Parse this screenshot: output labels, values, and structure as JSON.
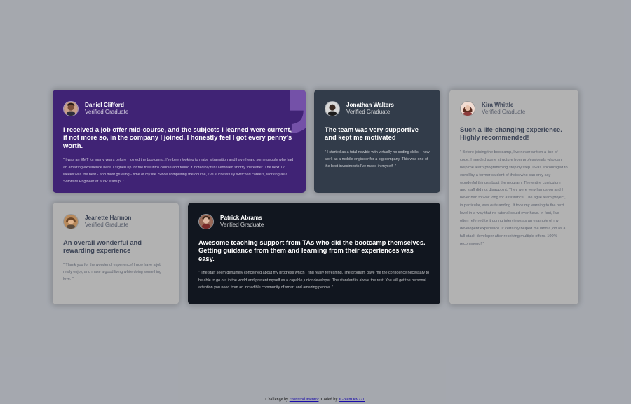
{
  "testimonials": [
    {
      "name": "Daniel Clifford",
      "role": "Verified Graduate",
      "avatar": "man-avatar-icon",
      "headline": "I received a job offer mid-course, and the subjects I learned were current, if not more so, in the company I joined. I honestly feel I got every penny's worth.",
      "body": "\" I was an EMT for many years before I joined the bootcamp. I've been looking to make a transition and have heard some people who had an amazing experience here. I signed up for the free intro course and found it incredibly fun! I enrolled shortly thereafter. The next 12 weeks was the best - and most grueling - time of my life. Since completing the course, I've successfully switched careers, working as a Software Engineer at a VR startup. \"",
      "background": "#5c33a8"
    },
    {
      "name": "Jonathan Walters",
      "role": "Verified Graduate",
      "avatar": "man-avatar-icon",
      "headline": "The team was very supportive and kept me motivated",
      "body": "\" I started as a total newbie with virtually no coding skills. I now work as a mobile engineer for a big company. This was one of the best investments I've made in myself. \"",
      "background": "#48566b"
    },
    {
      "name": "Jeanette Harmon",
      "role": "Verified Graduate",
      "avatar": "woman-avatar-icon",
      "headline": "An overall wonderful and rewarding experience",
      "body": "\" Thank you for the wonderful experience! I now have a job I really enjoy, and make a good living while doing something I love. \"",
      "background": "#ffffff"
    },
    {
      "name": "Patrick Abrams",
      "role": "Verified Graduate",
      "avatar": "man-avatar-icon",
      "headline": "Awesome teaching support from TAs who did the bootcamp themselves. Getting guidance from them and learning from their experiences was easy.",
      "body": "\" The staff seem genuinely concerned about my progress which I find really refreshing. The program gave me the confidence necessary to be able to go out in the world and present myself as a capable junior developer. The standard is above the rest. You will get the personal attention you need from an incredible community of smart and amazing people. \"",
      "background": "#19202d"
    },
    {
      "name": "Kira Whittle",
      "role": "Verified Graduate",
      "avatar": "woman-avatar-icon",
      "headline": "Such a life-changing experience. Highly recommended!",
      "body": "\" Before joining the bootcamp, I've never written a line of code. I needed some structure from professionals who can help me learn programming step by step. I was encouraged to enroll by a former student of theirs who can only say wonderful things about the program. The entire curriculum and staff did not disappoint. They were very hands-on and I never had to wait long for assistance. The agile team project, in particular, was outstanding. It took my learning to the next level in a way that no tutorial could ever have. In fact, I've often referred to it during interviews as an example of my developent experience. It certainly helped me land a job as a full-stack developer after receiving multiple offers. 100% recommend! \"",
      "background": "#ffffff"
    }
  ],
  "decorations": {
    "quote_icon": "quotation-mark-icon",
    "quote_color": "#a775f1"
  },
  "footer": {
    "prefix": "Challenge by ",
    "challenge_link": "Frontend Mentor",
    "middle": ". Coded by ",
    "author_link": "JGreenDev721",
    "suffix": "."
  }
}
